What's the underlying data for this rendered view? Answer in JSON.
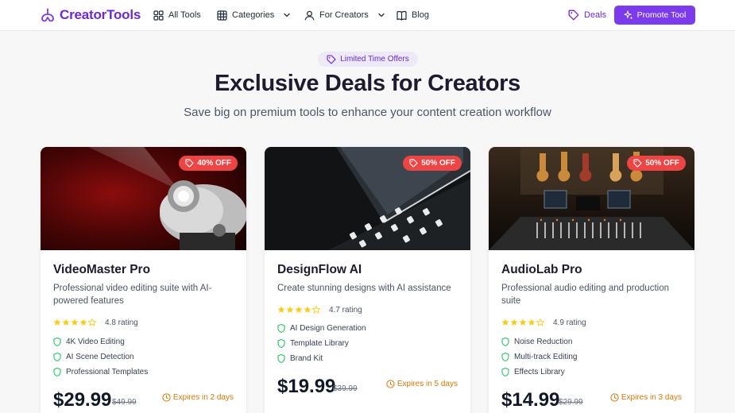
{
  "brand": {
    "name": "CreatorTools",
    "accent": "#7c3aed",
    "logo_icon": "hook-logo-icon"
  },
  "nav": {
    "all_tools": "All Tools",
    "categories": "Categories",
    "for_creators": "For Creators",
    "blog": "Blog",
    "deals": "Deals",
    "promote": "Promote Tool"
  },
  "hero": {
    "badge": "Limited Time Offers",
    "title": "Exclusive Deals for Creators",
    "subtitle": "Save big on premium tools to enhance your content creation workflow"
  },
  "colors": {
    "discount_badge": "#ef4444",
    "expires": "#d97706",
    "stars": "#facc15",
    "feature_check": "#22c55e"
  },
  "cards": [
    {
      "discount": "40% OFF",
      "title": "VideoMaster Pro",
      "description": "Professional video editing suite with AI-powered features",
      "stars": 4,
      "rating": "4.8 rating",
      "features": [
        "4K Video Editing",
        "AI Scene Detection",
        "Professional Templates"
      ],
      "price": "$29.99",
      "old_price": "$49.99",
      "expires": "Expires in 2 days",
      "image": "projector-photo"
    },
    {
      "discount": "50% OFF",
      "title": "DesignFlow AI",
      "description": "Create stunning designs with AI assistance",
      "stars": 4,
      "rating": "4.7 rating",
      "features": [
        "AI Design Generation",
        "Template Library",
        "Brand Kit"
      ],
      "price": "$19.99",
      "old_price": "$39.99",
      "expires": "Expires in 5 days",
      "image": "keyboard-tablet-photo"
    },
    {
      "discount": "50% OFF",
      "title": "AudioLab Pro",
      "description": "Professional audio editing and production suite",
      "stars": 4,
      "rating": "4.9 rating",
      "features": [
        "Noise Reduction",
        "Multi-track Editing",
        "Effects Library"
      ],
      "price": "$14.99",
      "old_price": "$29.99",
      "expires": "Expires in 3 days",
      "image": "music-studio-photo"
    }
  ]
}
